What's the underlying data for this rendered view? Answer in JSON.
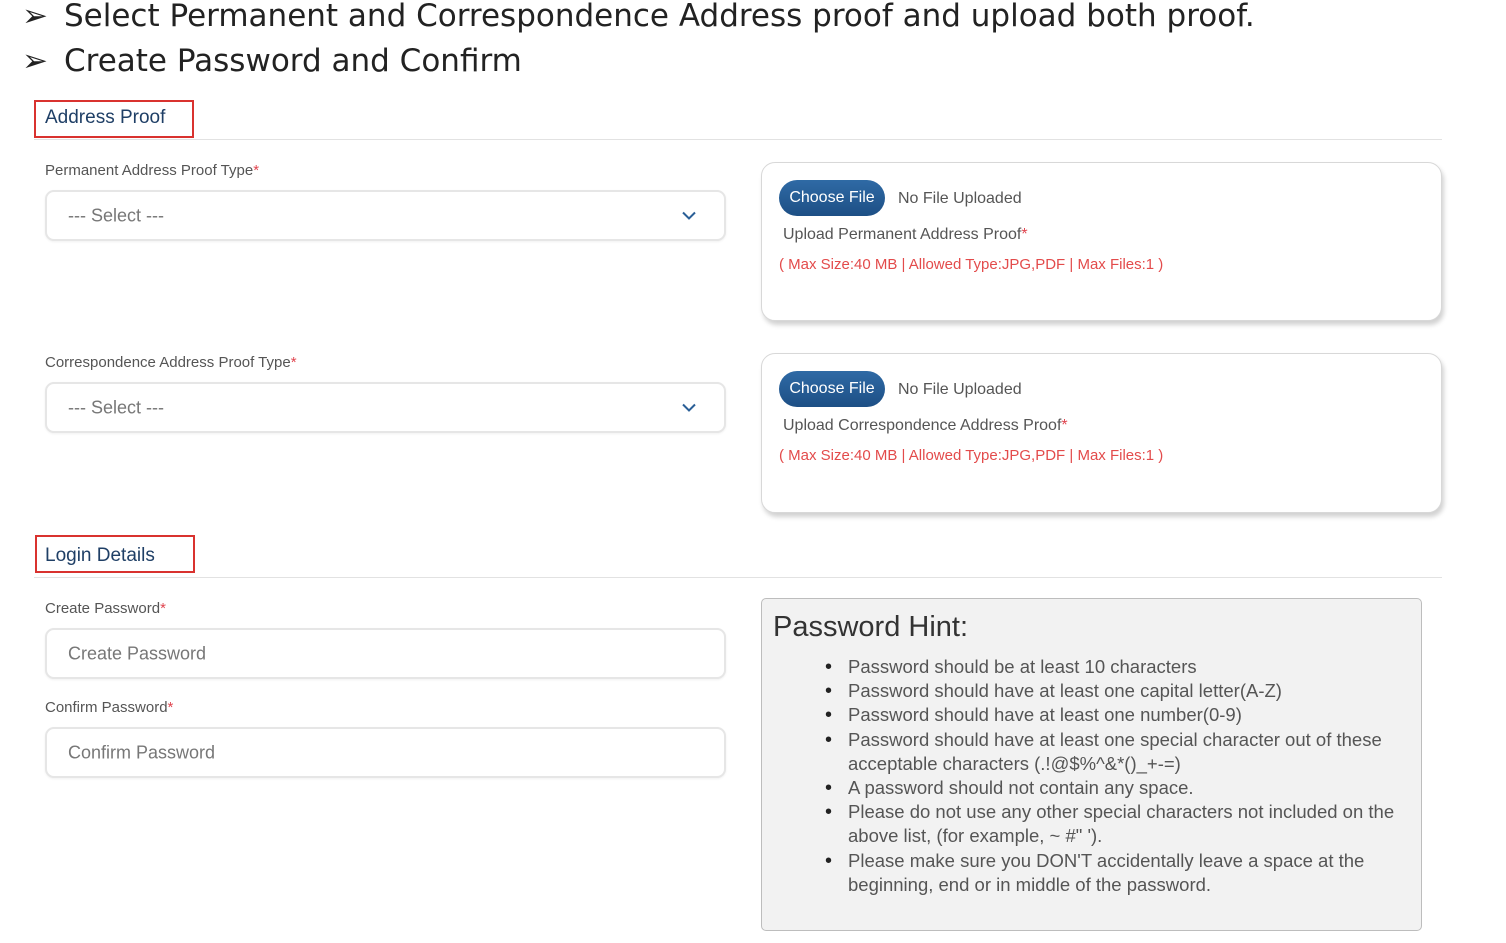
{
  "instructions": [
    "Select Permanent and Correspondence Address proof and upload both proof.",
    "Create Password and Confirm"
  ],
  "address_proof": {
    "title": "Address Proof",
    "permanent": {
      "label": "Permanent Address Proof Type",
      "select_value": "--- Select ---",
      "choose_file": "Choose File",
      "file_status": "No File Uploaded",
      "upload_label": "Upload Permanent Address Proof",
      "note": "( Max Size:40 MB | Allowed Type:JPG,PDF | Max Files:1 )"
    },
    "correspondence": {
      "label": "Correspondence Address Proof Type",
      "select_value": "--- Select ---",
      "choose_file": "Choose File",
      "file_status": "No File Uploaded",
      "upload_label": "Upload Correspondence Address Proof",
      "note": "( Max Size:40 MB | Allowed Type:JPG,PDF | Max Files:1 )"
    }
  },
  "login": {
    "title": "Login Details",
    "create_label": "Create Password",
    "create_placeholder": "Create Password",
    "confirm_label": "Confirm Password",
    "confirm_placeholder": "Confirm Password"
  },
  "required_marker": "*",
  "password_hint": {
    "title": "Password Hint:",
    "items": [
      "Password should be at least 10 characters",
      "Password should have at least one capital letter(A-Z)",
      "Password should have at least one number(0-9)",
      "Password should have at least one special character out of these acceptable characters (.!@$%^&*()_+-=)",
      "A password should not contain any space.",
      "Please do not use any other special characters not included on the above list, (for example, ~ #\" ').",
      "Please make sure you DON'T accidentally leave a space at the beginning, end or in middle of the password."
    ]
  },
  "colors": {
    "section_title": "#1f3f66",
    "highlight_box": "#d9322f",
    "required": "#e0454f",
    "button": "#2a5f97",
    "note": "#e34b4b",
    "hint_bg": "#f2f2f2"
  }
}
